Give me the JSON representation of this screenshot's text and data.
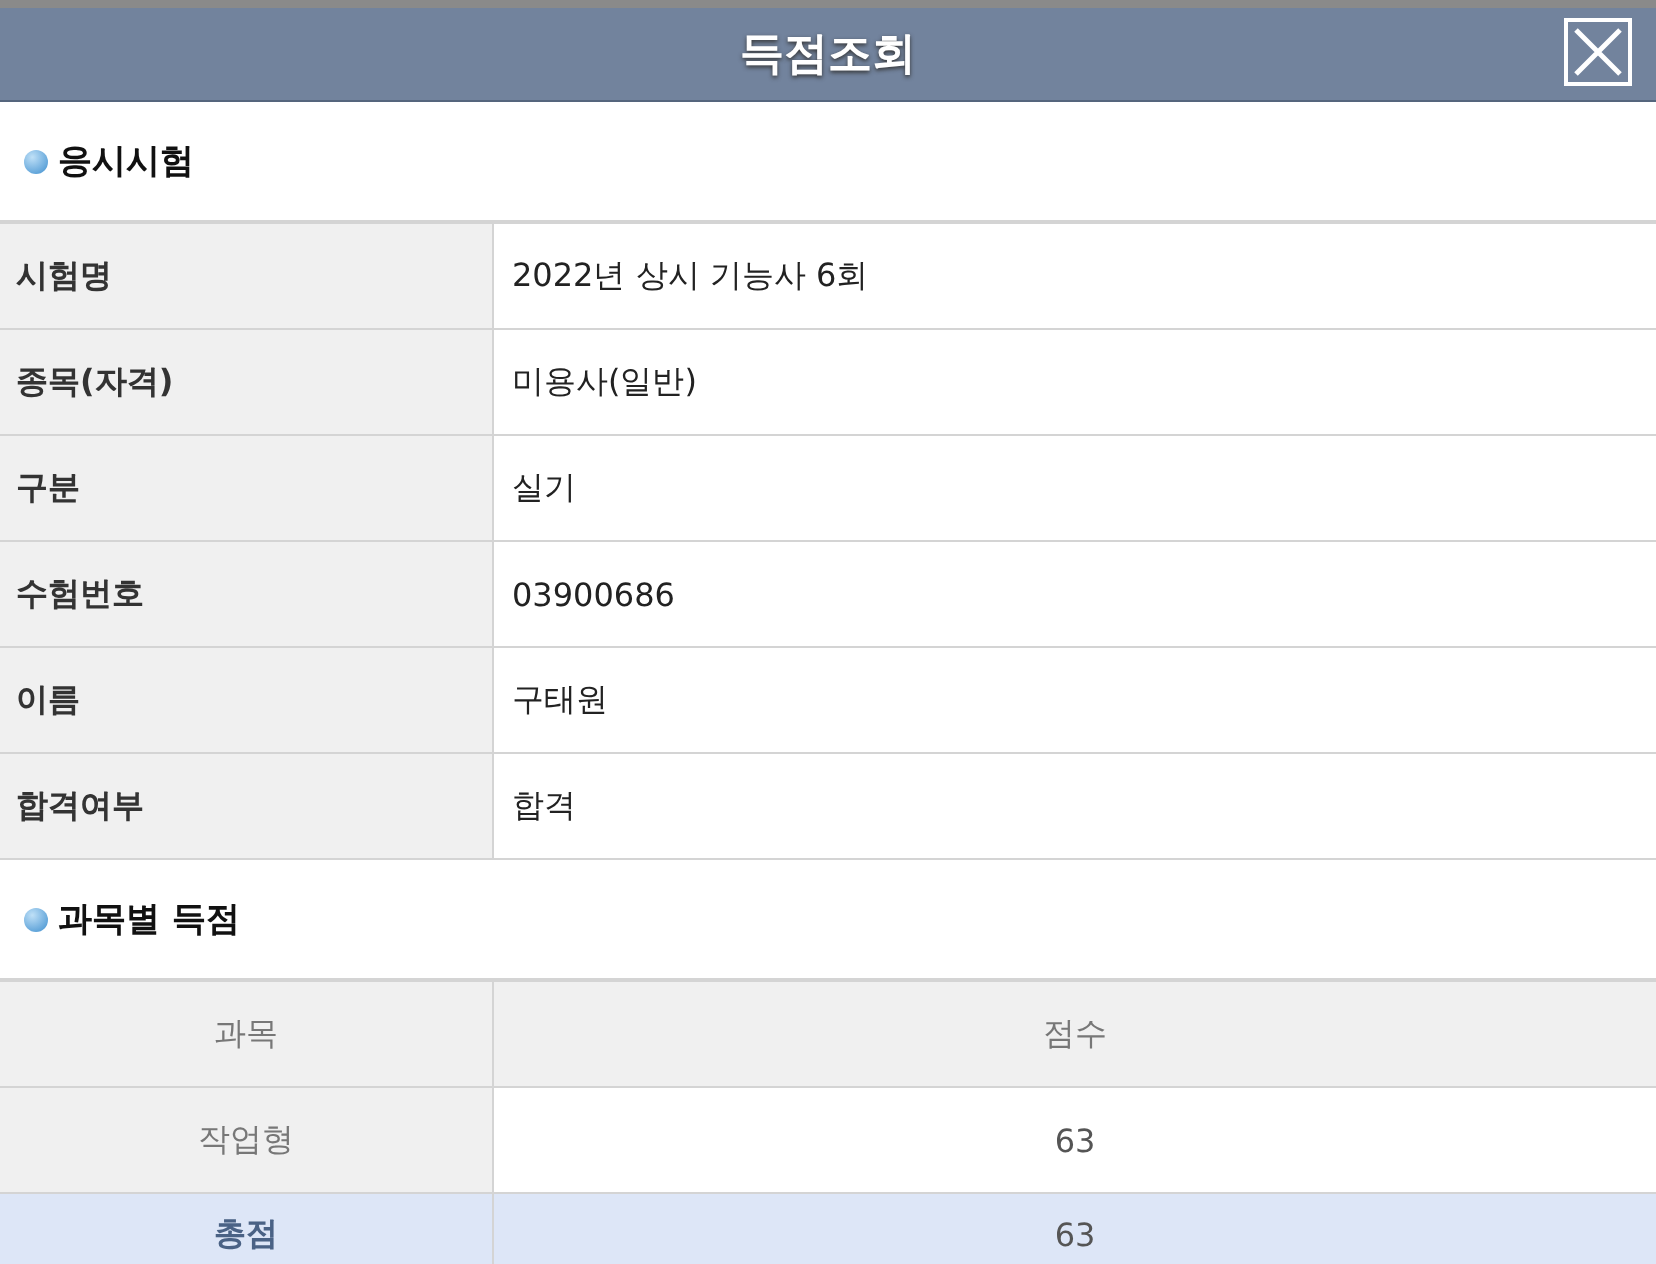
{
  "header": {
    "title": "득점조회"
  },
  "exam_section": {
    "title": "응시시험",
    "rows": [
      {
        "label": "시험명",
        "value": "2022년 상시 기능사 6회"
      },
      {
        "label": "종목(자격)",
        "value": "미용사(일반)"
      },
      {
        "label": "구분",
        "value": "실기"
      },
      {
        "label": "수험번호",
        "value": "03900686"
      },
      {
        "label": "이름",
        "value": "구태원"
      },
      {
        "label": "합격여부",
        "value": "합격"
      }
    ]
  },
  "score_section": {
    "title": "과목별 득점",
    "columns": [
      "과목",
      "점수"
    ],
    "rows": [
      {
        "kind": "subject",
        "subject": "작업형",
        "score": "63"
      },
      {
        "kind": "total",
        "subject": "총점",
        "score": "63"
      }
    ]
  }
}
